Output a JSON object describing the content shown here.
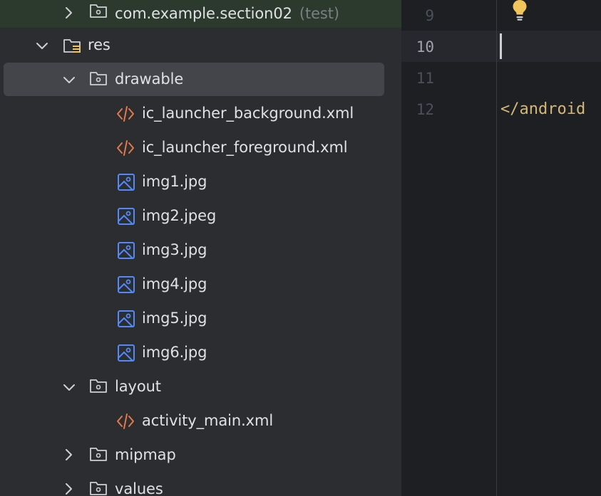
{
  "tree": {
    "items": [
      {
        "label": "com.example.section02",
        "suffix": "(test)",
        "icon": "folder-icon",
        "expanded": false
      },
      {
        "label": "res",
        "icon": "resource-folder-icon",
        "expanded": true
      },
      {
        "label": "drawable",
        "icon": "folder-icon",
        "expanded": true,
        "selected": true
      },
      {
        "label": "ic_launcher_background.xml",
        "icon": "xml-file-icon"
      },
      {
        "label": "ic_launcher_foreground.xml",
        "icon": "xml-file-icon"
      },
      {
        "label": "img1.jpg",
        "icon": "image-file-icon"
      },
      {
        "label": "img2.jpeg",
        "icon": "image-file-icon"
      },
      {
        "label": "img3.jpg",
        "icon": "image-file-icon"
      },
      {
        "label": "img4.jpg",
        "icon": "image-file-icon"
      },
      {
        "label": "img5.jpg",
        "icon": "image-file-icon"
      },
      {
        "label": "img6.jpg",
        "icon": "image-file-icon"
      },
      {
        "label": "layout",
        "icon": "folder-icon",
        "expanded": true
      },
      {
        "label": "activity_main.xml",
        "icon": "xml-file-icon"
      },
      {
        "label": "mipmap",
        "icon": "folder-icon",
        "expanded": false
      },
      {
        "label": "values",
        "icon": "folder-icon",
        "expanded": false
      }
    ]
  },
  "editor": {
    "line_numbers": [
      "9",
      "10",
      "11",
      "12"
    ],
    "active_line": "10",
    "lines": {
      "line12": "</android"
    },
    "intention_icon": "lightbulb-icon"
  },
  "colors": {
    "xml_icon": "#e07a4a",
    "image_icon": "#548af7",
    "bulb": "#f2c55c"
  }
}
